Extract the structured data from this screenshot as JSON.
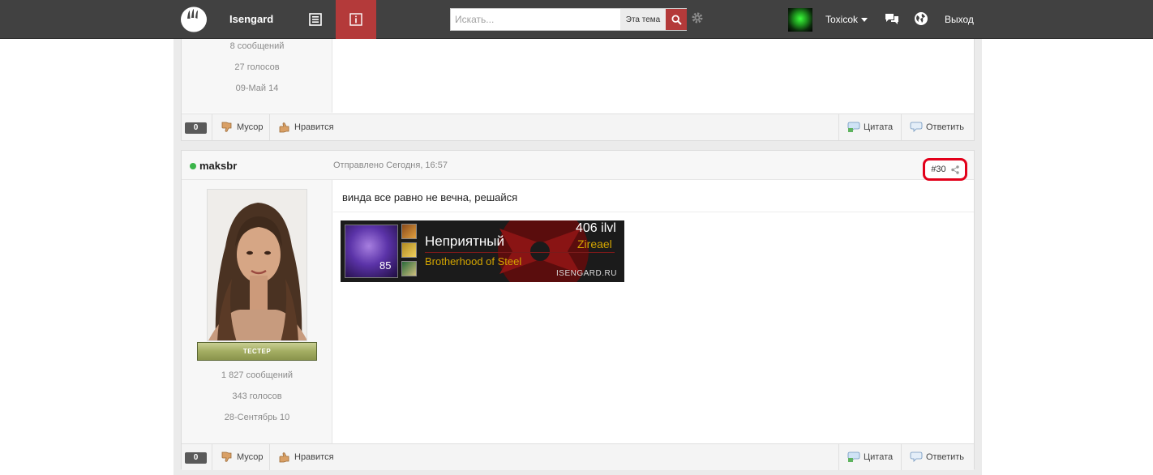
{
  "header": {
    "site_name": "Isengard",
    "search": {
      "placeholder": "Искать...",
      "scope": "Эта тема"
    },
    "user": {
      "name": "Toxicok"
    },
    "logout": "Выход"
  },
  "posts": [
    {
      "author_stats": {
        "messages": "8 сообщений",
        "votes": "27 голосов",
        "joined": "09-Май 14"
      },
      "rating": "0",
      "actions": {
        "trash": "Мусор",
        "like": "Нравится",
        "quote": "Цитата",
        "reply": "Ответить"
      }
    },
    {
      "author": "maksbr",
      "posted": "Отправлено Сегодня, 16:57",
      "post_number": "#30",
      "text": "винда все равно не вечна, решайся",
      "rank_badge": "ТЕСТЕР",
      "author_stats": {
        "messages": "1 827 сообщений",
        "votes": "343 голосов",
        "joined": "28-Сентябрь 10"
      },
      "signature": {
        "character": "Неприятный",
        "ilvl": "406 ilvl",
        "realm": "Zireael",
        "guild": "Brotherhood of Steel",
        "level": "85",
        "site": "ISENGARD.RU"
      },
      "rating": "0",
      "actions": {
        "trash": "Мусор",
        "like": "Нравится",
        "quote": "Цитата",
        "reply": "Ответить"
      }
    }
  ],
  "colors": {
    "topbar": "#414141",
    "accent_red": "#b43a3a",
    "highlight": "#e2001a",
    "online": "#3bb54a",
    "gold": "#d4a600"
  },
  "icons": [
    "site-logo-icon",
    "list-icon",
    "info-icon",
    "search-icon",
    "gear-icon",
    "caret-down-icon",
    "chat-icon",
    "globe-icon",
    "thumbs-down-icon",
    "thumbs-up-icon",
    "quote-icon",
    "reply-icon",
    "share-icon"
  ]
}
